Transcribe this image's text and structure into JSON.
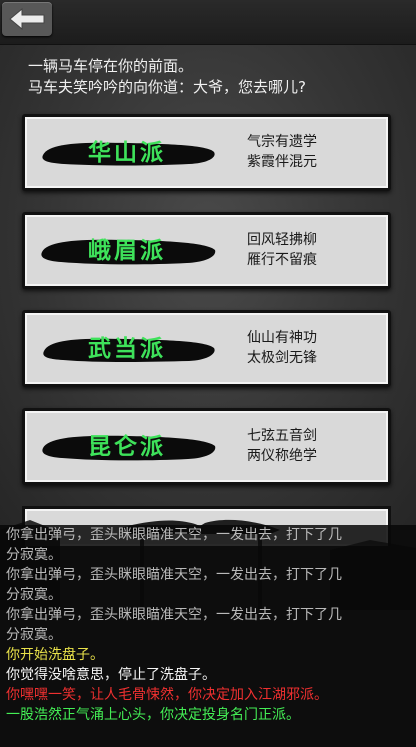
{
  "header": {
    "back_icon": "back-arrow-icon"
  },
  "intro": {
    "line1": "一辆马车停在你的前面。",
    "line2": "马车夫笑吟吟的向你道：大爷，您去哪儿?"
  },
  "sects": [
    {
      "name": "华山派",
      "motto1": "气宗有遗学",
      "motto2": "紫霞伴混元"
    },
    {
      "name": "峨眉派",
      "motto1": "回风轻拂柳",
      "motto2": "雁行不留痕"
    },
    {
      "name": "武当派",
      "motto1": "仙山有神功",
      "motto2": "太极剑无锋"
    },
    {
      "name": "昆仑派",
      "motto1": "七弦五音剑",
      "motto2": "两仪称绝学"
    }
  ],
  "log": [
    {
      "text": "你拿出弹弓，歪头眯眼瞄准天空，一发出去，打下了几",
      "color": "grey"
    },
    {
      "text": "分寂寞。",
      "color": "grey"
    },
    {
      "text": "你拿出弹弓，歪头眯眼瞄准天空，一发出去，打下了几",
      "color": "grey"
    },
    {
      "text": "分寂寞。",
      "color": "grey"
    },
    {
      "text": "你拿出弹弓，歪头眯眼瞄准天空，一发出去，打下了几",
      "color": "grey"
    },
    {
      "text": "分寂寞。",
      "color": "grey"
    },
    {
      "text": "你开始洗盘子。",
      "color": "yellow"
    },
    {
      "text": "你觉得没啥意思，停止了洗盘子。",
      "color": "white"
    },
    {
      "text": "你嘿嘿一笑，让人毛骨悚然，你决定加入江湖邪派。",
      "color": "red"
    },
    {
      "text": "一股浩然正气涌上心头，你决定投身名门正派。",
      "color": "green"
    }
  ],
  "colors": {
    "sect_name": "#3ee25a",
    "log_grey": "#b9b9b9",
    "log_yellow": "#e8e14a",
    "log_red": "#ee3030",
    "log_green": "#44ee55"
  }
}
